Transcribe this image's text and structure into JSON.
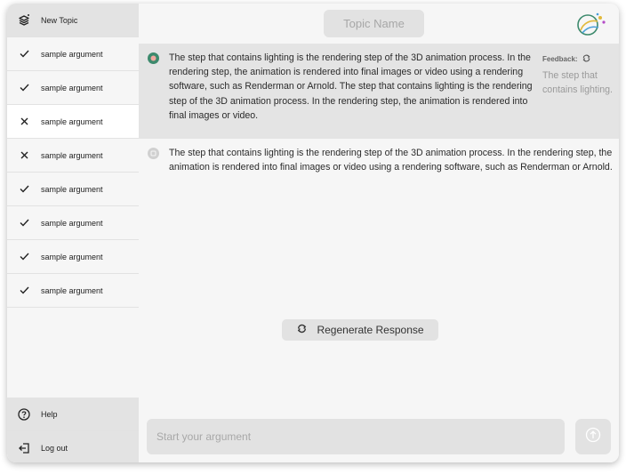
{
  "sidebar": {
    "new_topic": {
      "label": "New Topic",
      "icon": "layers-icon"
    },
    "items": [
      {
        "label": "sample argument",
        "status": "check"
      },
      {
        "label": "sample argument",
        "status": "check"
      },
      {
        "label": "sample argument",
        "status": "cross"
      },
      {
        "label": "sample argument",
        "status": "cross"
      },
      {
        "label": "sample argument",
        "status": "check"
      },
      {
        "label": "sample argument",
        "status": "check"
      },
      {
        "label": "sample argument",
        "status": "check"
      },
      {
        "label": "sample argument",
        "status": "check"
      }
    ],
    "help": {
      "label": "Help",
      "icon": "help-circle-icon"
    },
    "logout": {
      "label": "Log out",
      "icon": "logout-icon"
    }
  },
  "header": {
    "topic_name": "Topic Name",
    "logo_icon": "app-logo-icon"
  },
  "messages": [
    {
      "text": "The step that contains lighting is the rendering step of the 3D animation process. In the rendering step, the animation is rendered into final images or video using a rendering software, such as Renderman or Arnold. The step that contains lighting is the rendering step of the 3D animation process. In the rendering step, the animation is rendered into final images or video.",
      "icon_color": "#3d8a6d"
    },
    {
      "text": "The step that contains lighting is the rendering step of the 3D animation process. In the rendering step, the animation is rendered into final images or video using a rendering software, such as Renderman or Arnold.",
      "icon_color": "#d0d0d0"
    }
  ],
  "feedback": {
    "title": "Feedback:",
    "text": "The step that contains lighting."
  },
  "regenerate_label": "Regenerate Response",
  "input": {
    "placeholder": "Start your argument",
    "value": ""
  },
  "colors": {
    "accent_green": "#3d8a6d",
    "panel": "#f6f6f6",
    "highlight": "#e4e4e4"
  }
}
